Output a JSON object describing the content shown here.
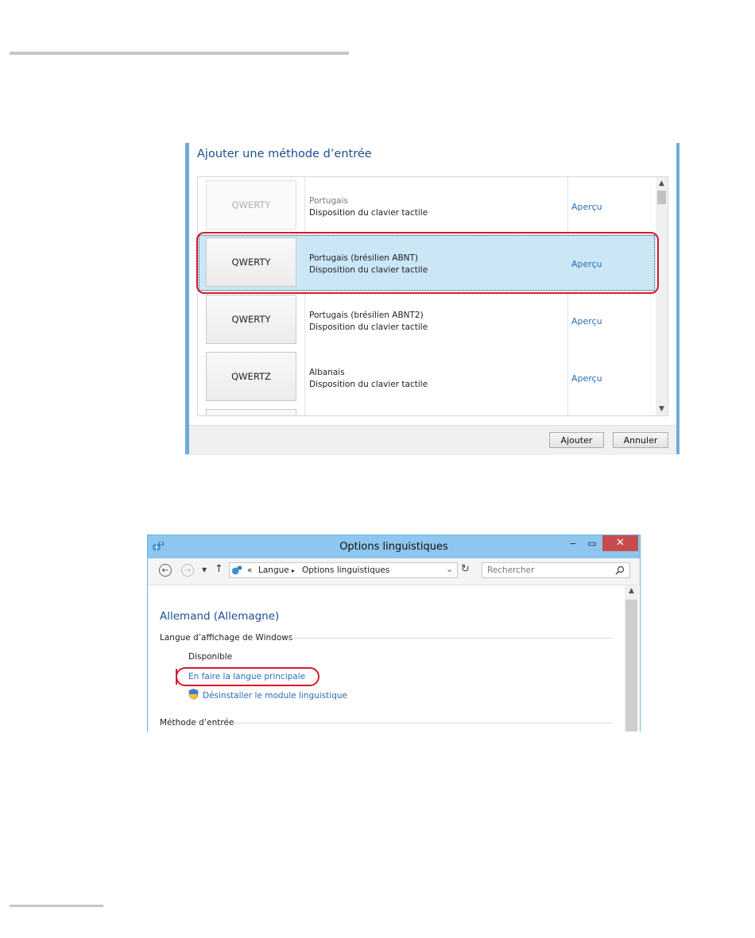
{
  "dialog": {
    "title": "Ajouter une méthode d’entrée",
    "items": [
      {
        "layout": "QWERTY",
        "name": "Portugais",
        "subtitle": "Disposition du clavier tactile",
        "link": "Aperçu",
        "state": "faded"
      },
      {
        "layout": "QWERTY",
        "name": "Portugais (brésilien ABNT)",
        "subtitle": "Disposition du clavier tactile",
        "link": "Aperçu",
        "state": "selected"
      },
      {
        "layout": "QWERTY",
        "name": "Portugais (brésilien ABNT2)",
        "subtitle": "Disposition du clavier tactile",
        "link": "Aperçu",
        "state": "normal"
      },
      {
        "layout": "QWERTZ",
        "name": "Albanais",
        "subtitle": "Disposition du clavier tactile",
        "link": "Aperçu",
        "state": "normal"
      }
    ],
    "buttons": {
      "add": "Ajouter",
      "cancel": "Annuler"
    }
  },
  "window": {
    "title": "Options linguistiques",
    "breadcrumb": {
      "prefix": "«",
      "root": "Langue",
      "separator": "▸",
      "current": "Options linguistiques"
    },
    "search_placeholder": "Rechercher",
    "language_title": "Allemand (Allemagne)",
    "display_section": "Langue d’affichage de Windows",
    "status": "Disponible",
    "make_primary_link": "En faire la langue principale",
    "uninstall_link": "Désinstaller le module linguistique",
    "input_section": "Méthode d’entrée"
  },
  "colors": {
    "accent": "#6cabdf",
    "link": "#2a6ebb",
    "highlight": "#d7192d",
    "selection": "#cbe6f5"
  }
}
